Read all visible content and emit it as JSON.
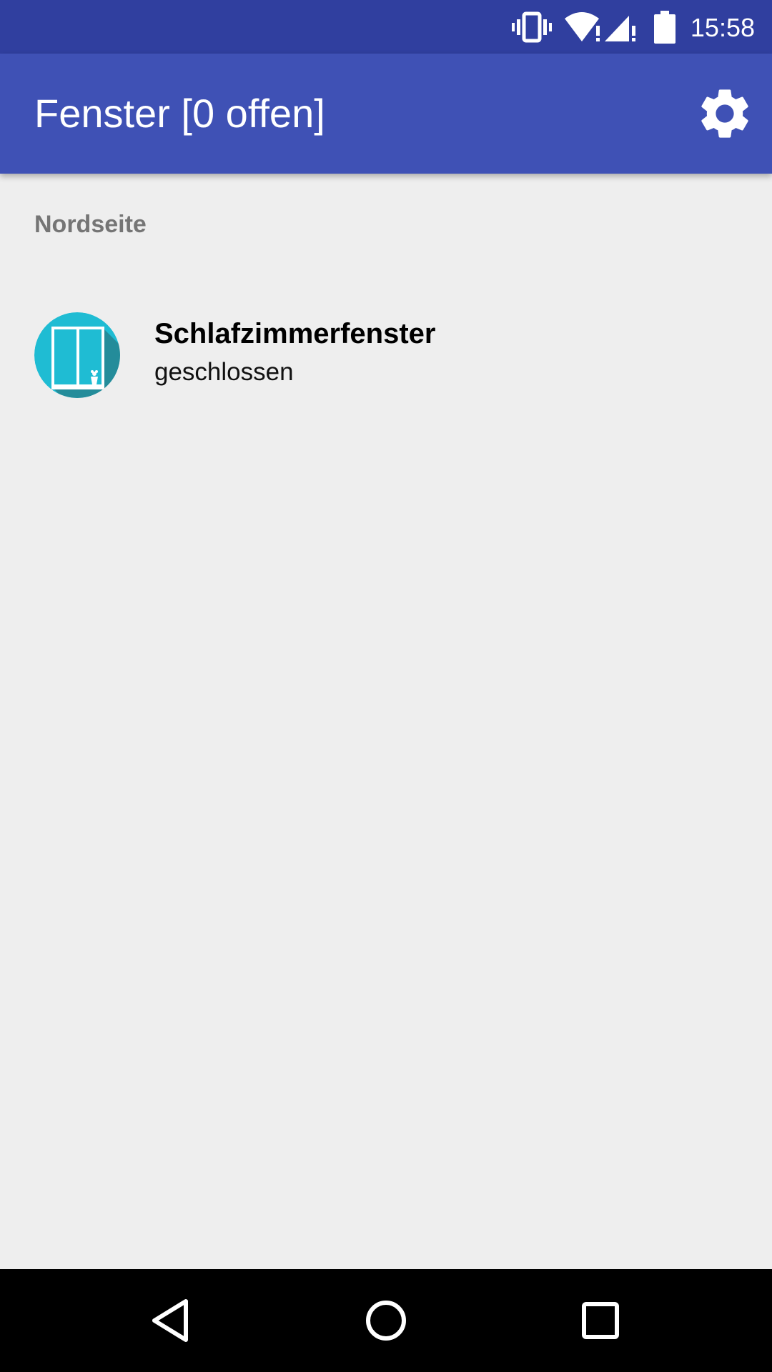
{
  "status_bar": {
    "time": "15:58",
    "icons": [
      "vibrate-icon",
      "wifi-alert-icon",
      "signal-alert-icon",
      "battery-icon"
    ]
  },
  "app_bar": {
    "title": "Fenster [0 offen]",
    "settings_icon": "gear-icon"
  },
  "sections": [
    {
      "header": "Nordseite",
      "items": [
        {
          "title": "Schlafzimmerfenster",
          "status": "geschlossen",
          "icon": "window-icon"
        }
      ]
    }
  ],
  "nav_bar": {
    "icons": [
      "back-icon",
      "home-icon",
      "recents-icon"
    ]
  },
  "colors": {
    "status_bar": "#303f9f",
    "app_bar": "#3f51b5",
    "background": "#eeeeee",
    "avatar": "#1fbcd3",
    "avatar_shadow": "#26848f"
  }
}
